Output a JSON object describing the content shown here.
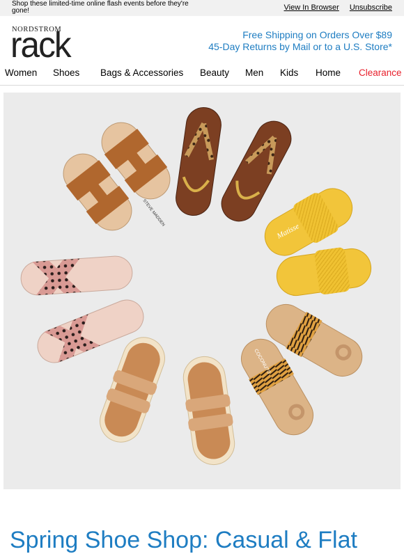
{
  "preheader": "Shop these limited-time online flash events before they're gone!",
  "top_links": {
    "view_in_browser": "View In Browser",
    "unsubscribe": "Unsubscribe"
  },
  "brand": {
    "small": "NORDSTROM",
    "big": "rack"
  },
  "promo": {
    "line1": "Free Shipping on Orders Over $89",
    "line2": "45-Day Returns by Mail or to a U.S. Store*"
  },
  "nav": [
    "Women",
    "Shoes",
    "Bags & Accessories",
    "Beauty",
    "Men",
    "Kids",
    "Home",
    "Clearance"
  ],
  "hero": {
    "labels": {
      "steve": "STEVE MADDEN",
      "matisse": "Matisse",
      "coconuts": "COCONUTS",
      "by": "by Matisse"
    }
  },
  "headline": "Spring Shoe Shop: Casual & Flat",
  "colors": {
    "accent_blue": "#1e7dc2",
    "clearance_red": "#e8202c",
    "topbar_bg": "#f1f1f1",
    "hero_bg": "#ebebeb"
  }
}
